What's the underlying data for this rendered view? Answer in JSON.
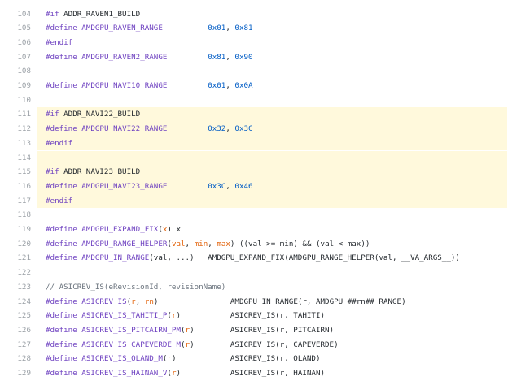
{
  "lines": [
    {
      "n": "104",
      "hl": false,
      "tokens": [
        {
          "t": "#if",
          "c": "kw"
        },
        {
          "t": " ADDR_RAVEN1_BUILD",
          "c": "txt"
        }
      ]
    },
    {
      "n": "105",
      "hl": false,
      "tokens": [
        {
          "t": "#define",
          "c": "kw"
        },
        {
          "t": " ",
          "c": "txt"
        },
        {
          "t": "AMDGPU_RAVEN_RANGE",
          "c": "mac"
        },
        {
          "t": "          ",
          "c": "txt"
        },
        {
          "t": "0x01",
          "c": "num"
        },
        {
          "t": ", ",
          "c": "txt"
        },
        {
          "t": "0x81",
          "c": "num"
        }
      ]
    },
    {
      "n": "106",
      "hl": false,
      "tokens": [
        {
          "t": "#endif",
          "c": "kw"
        }
      ]
    },
    {
      "n": "107",
      "hl": false,
      "tokens": [
        {
          "t": "#define",
          "c": "kw"
        },
        {
          "t": " ",
          "c": "txt"
        },
        {
          "t": "AMDGPU_RAVEN2_RANGE",
          "c": "mac"
        },
        {
          "t": "         ",
          "c": "txt"
        },
        {
          "t": "0x81",
          "c": "num"
        },
        {
          "t": ", ",
          "c": "txt"
        },
        {
          "t": "0x90",
          "c": "num"
        }
      ]
    },
    {
      "n": "108",
      "hl": false,
      "tokens": []
    },
    {
      "n": "109",
      "hl": false,
      "tokens": [
        {
          "t": "#define",
          "c": "kw"
        },
        {
          "t": " ",
          "c": "txt"
        },
        {
          "t": "AMDGPU_NAVI10_RANGE",
          "c": "mac"
        },
        {
          "t": "         ",
          "c": "txt"
        },
        {
          "t": "0x01",
          "c": "num"
        },
        {
          "t": ", ",
          "c": "txt"
        },
        {
          "t": "0x0A",
          "c": "num"
        }
      ]
    },
    {
      "n": "110",
      "hl": false,
      "tokens": []
    },
    {
      "n": "111",
      "hl": true,
      "tokens": [
        {
          "t": "#if",
          "c": "kw"
        },
        {
          "t": " ADDR_NAVI22_BUILD",
          "c": "txt"
        }
      ]
    },
    {
      "n": "112",
      "hl": true,
      "tokens": [
        {
          "t": "#define",
          "c": "kw"
        },
        {
          "t": " ",
          "c": "txt"
        },
        {
          "t": "AMDGPU_NAVI22_RANGE",
          "c": "mac"
        },
        {
          "t": "         ",
          "c": "txt"
        },
        {
          "t": "0x32",
          "c": "num"
        },
        {
          "t": ", ",
          "c": "txt"
        },
        {
          "t": "0x3C",
          "c": "num"
        }
      ]
    },
    {
      "n": "113",
      "hl": true,
      "tokens": [
        {
          "t": "#endif",
          "c": "kw"
        }
      ]
    },
    {
      "n": "114",
      "hl": true,
      "tokens": []
    },
    {
      "n": "115",
      "hl": true,
      "tokens": [
        {
          "t": "#if",
          "c": "kw"
        },
        {
          "t": " ADDR_NAVI23_BUILD",
          "c": "txt"
        }
      ]
    },
    {
      "n": "116",
      "hl": true,
      "tokens": [
        {
          "t": "#define",
          "c": "kw"
        },
        {
          "t": " ",
          "c": "txt"
        },
        {
          "t": "AMDGPU_NAVI23_RANGE",
          "c": "mac"
        },
        {
          "t": "         ",
          "c": "txt"
        },
        {
          "t": "0x3C",
          "c": "num"
        },
        {
          "t": ", ",
          "c": "txt"
        },
        {
          "t": "0x46",
          "c": "num"
        }
      ]
    },
    {
      "n": "117",
      "hl": true,
      "tokens": [
        {
          "t": "#endif",
          "c": "kw"
        }
      ]
    },
    {
      "n": "118",
      "hl": false,
      "tokens": []
    },
    {
      "n": "119",
      "hl": false,
      "tokens": [
        {
          "t": "#define",
          "c": "kw"
        },
        {
          "t": " ",
          "c": "txt"
        },
        {
          "t": "AMDGPU_EXPAND_FIX",
          "c": "mac"
        },
        {
          "t": "(",
          "c": "txt"
        },
        {
          "t": "x",
          "c": "par"
        },
        {
          "t": ") x",
          "c": "txt"
        }
      ]
    },
    {
      "n": "120",
      "hl": false,
      "tokens": [
        {
          "t": "#define",
          "c": "kw"
        },
        {
          "t": " ",
          "c": "txt"
        },
        {
          "t": "AMDGPU_RANGE_HELPER",
          "c": "mac"
        },
        {
          "t": "(",
          "c": "txt"
        },
        {
          "t": "val",
          "c": "par"
        },
        {
          "t": ", ",
          "c": "txt"
        },
        {
          "t": "min",
          "c": "par"
        },
        {
          "t": ", ",
          "c": "txt"
        },
        {
          "t": "max",
          "c": "par"
        },
        {
          "t": ") ((val >= min) && (val < max))",
          "c": "txt"
        }
      ]
    },
    {
      "n": "121",
      "hl": false,
      "tokens": [
        {
          "t": "#define",
          "c": "kw"
        },
        {
          "t": " ",
          "c": "txt"
        },
        {
          "t": "AMDGPU_IN_RANGE",
          "c": "mac"
        },
        {
          "t": "(val, ...)   AMDGPU_EXPAND_FIX(AMDGPU_RANGE_HELPER(val, __VA_ARGS__))",
          "c": "txt"
        }
      ]
    },
    {
      "n": "122",
      "hl": false,
      "tokens": []
    },
    {
      "n": "123",
      "hl": false,
      "tokens": [
        {
          "t": "// ASICREV_IS(eRevisionId, revisionName)",
          "c": "cmt"
        }
      ]
    },
    {
      "n": "124",
      "hl": false,
      "tokens": [
        {
          "t": "#define",
          "c": "kw"
        },
        {
          "t": " ",
          "c": "txt"
        },
        {
          "t": "ASICREV_IS",
          "c": "mac"
        },
        {
          "t": "(",
          "c": "txt"
        },
        {
          "t": "r",
          "c": "par"
        },
        {
          "t": ", ",
          "c": "txt"
        },
        {
          "t": "rn",
          "c": "par"
        },
        {
          "t": ")                AMDGPU_IN_RANGE(r, AMDGPU_##rn##_RANGE)",
          "c": "txt"
        }
      ]
    },
    {
      "n": "125",
      "hl": false,
      "tokens": [
        {
          "t": "#define",
          "c": "kw"
        },
        {
          "t": " ",
          "c": "txt"
        },
        {
          "t": "ASICREV_IS_TAHITI_P",
          "c": "mac"
        },
        {
          "t": "(",
          "c": "txt"
        },
        {
          "t": "r",
          "c": "par"
        },
        {
          "t": ")           ASICREV_IS(r, TAHITI)",
          "c": "txt"
        }
      ]
    },
    {
      "n": "126",
      "hl": false,
      "tokens": [
        {
          "t": "#define",
          "c": "kw"
        },
        {
          "t": " ",
          "c": "txt"
        },
        {
          "t": "ASICREV_IS_PITCAIRN_PM",
          "c": "mac"
        },
        {
          "t": "(",
          "c": "txt"
        },
        {
          "t": "r",
          "c": "par"
        },
        {
          "t": ")        ASICREV_IS(r, PITCAIRN)",
          "c": "txt"
        }
      ]
    },
    {
      "n": "127",
      "hl": false,
      "tokens": [
        {
          "t": "#define",
          "c": "kw"
        },
        {
          "t": " ",
          "c": "txt"
        },
        {
          "t": "ASICREV_IS_CAPEVERDE_M",
          "c": "mac"
        },
        {
          "t": "(",
          "c": "txt"
        },
        {
          "t": "r",
          "c": "par"
        },
        {
          "t": ")        ASICREV_IS(r, CAPEVERDE)",
          "c": "txt"
        }
      ]
    },
    {
      "n": "128",
      "hl": false,
      "tokens": [
        {
          "t": "#define",
          "c": "kw"
        },
        {
          "t": " ",
          "c": "txt"
        },
        {
          "t": "ASICREV_IS_OLAND_M",
          "c": "mac"
        },
        {
          "t": "(",
          "c": "txt"
        },
        {
          "t": "r",
          "c": "par"
        },
        {
          "t": ")            ASICREV_IS(r, OLAND)",
          "c": "txt"
        }
      ]
    },
    {
      "n": "129",
      "hl": false,
      "tokens": [
        {
          "t": "#define",
          "c": "kw"
        },
        {
          "t": " ",
          "c": "txt"
        },
        {
          "t": "ASICREV_IS_HAINAN_V",
          "c": "mac"
        },
        {
          "t": "(",
          "c": "txt"
        },
        {
          "t": "r",
          "c": "par"
        },
        {
          "t": ")           ASICREV_IS(r, HAINAN)",
          "c": "txt"
        }
      ]
    }
  ]
}
